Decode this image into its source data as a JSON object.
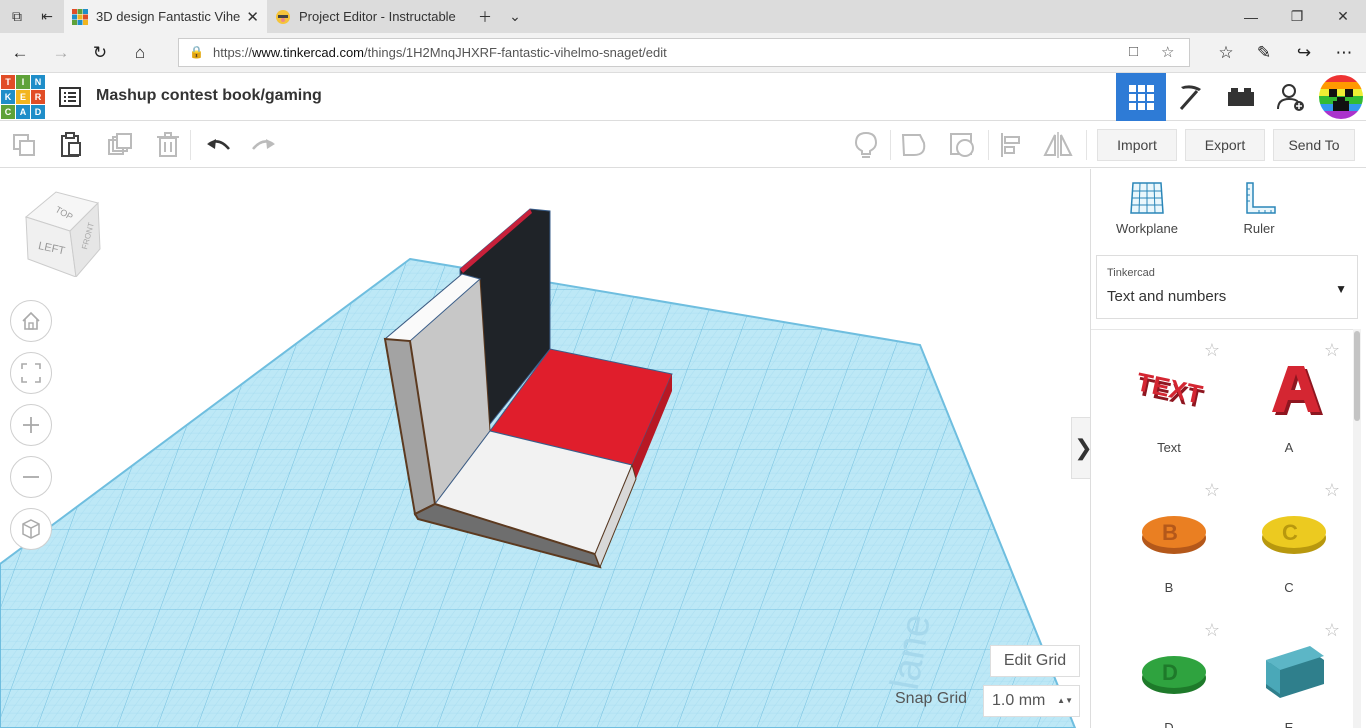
{
  "browser": {
    "tabs": [
      {
        "title": "3D design Fantastic Vihe",
        "active": true
      },
      {
        "title": "Project Editor - Instructable",
        "active": false
      }
    ],
    "url_prefix": "https://",
    "url_domain": "www.tinkercad.com",
    "url_path": "/things/1H2MnqJHXRF-fantastic-vihelmo-snaget/edit"
  },
  "logo": [
    "T",
    "I",
    "N",
    "K",
    "E",
    "R",
    "C",
    "A",
    "D"
  ],
  "header": {
    "design_title": "Mashup contest book/gaming"
  },
  "toolbar": {
    "import_label": "Import",
    "export_label": "Export",
    "sendto_label": "Send To"
  },
  "viewcube": {
    "top": "TOP",
    "left": "LEFT",
    "front": "FRONT"
  },
  "viewport": {
    "edit_grid_label": "Edit Grid",
    "snap_grid_label": "Snap Grid",
    "snap_grid_value": "1.0 mm"
  },
  "panel": {
    "workplane_label": "Workplane",
    "ruler_label": "Ruler",
    "library_category": "Tinkercad",
    "library_value": "Text and numbers",
    "shapes": [
      {
        "label": "Text",
        "color": "#c8202c"
      },
      {
        "label": "A",
        "color": "#c8202c"
      },
      {
        "label": "B",
        "color": "#e8781c"
      },
      {
        "label": "C",
        "color": "#e8c81c"
      },
      {
        "label": "D",
        "color": "#2ca03c"
      },
      {
        "label": "E",
        "color": "#4aa8b8"
      }
    ]
  },
  "colors": {
    "accent": "#2e7bd6",
    "grid": "#a8dff2"
  }
}
